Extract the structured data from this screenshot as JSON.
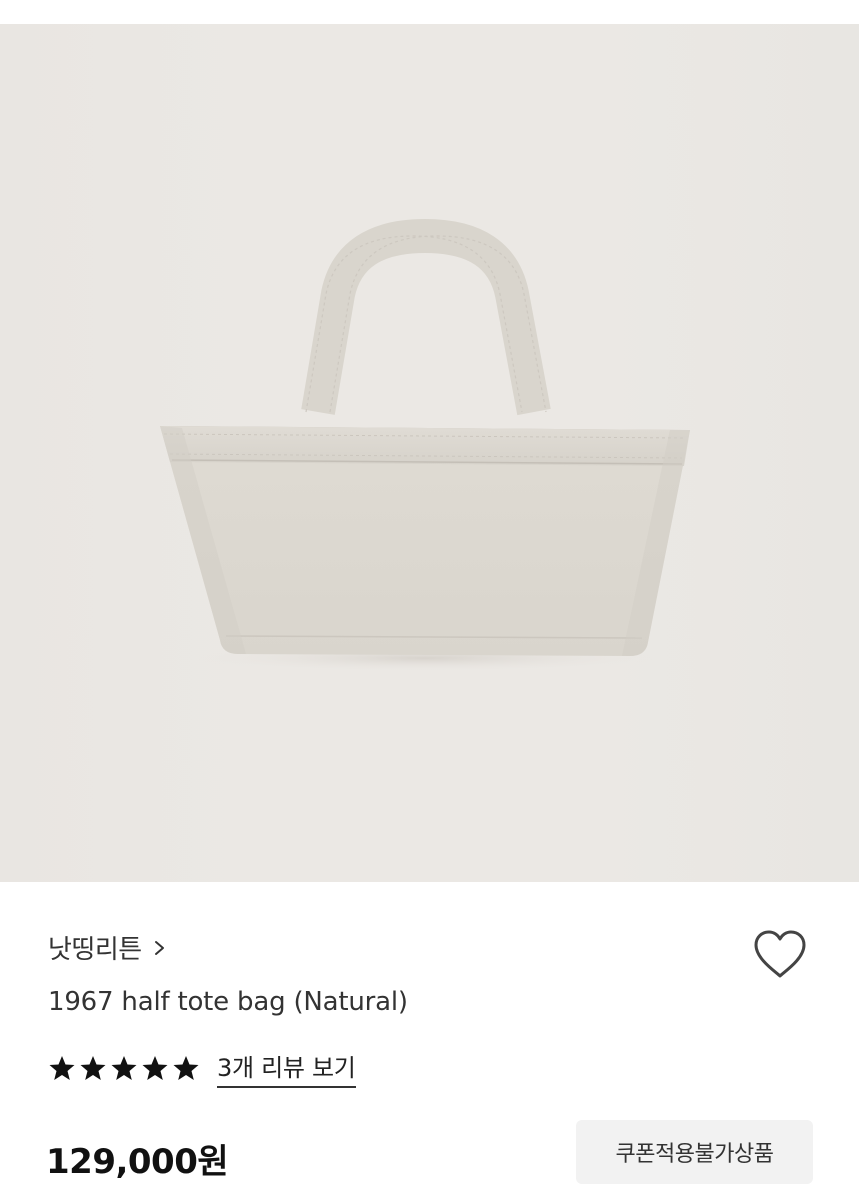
{
  "product": {
    "image_alt": "1967 half tote bag (Natural)",
    "brand": "낫띵리튼",
    "title": "1967 half tote bag (Natural)",
    "rating_stars": 5,
    "review_link": "3개 리뷰 보기",
    "price": "129,000원",
    "coupon_badge": "쿠폰적용불가상품"
  },
  "icons": {
    "brand": "chevron-right-icon",
    "wishlist": "heart-outline-icon",
    "star": "star-filled-icon"
  },
  "colors": {
    "hero_background": "#ebe8e4",
    "bag": "#ddd9d1",
    "text": "#333333",
    "badge_background": "#f2f2f2"
  }
}
